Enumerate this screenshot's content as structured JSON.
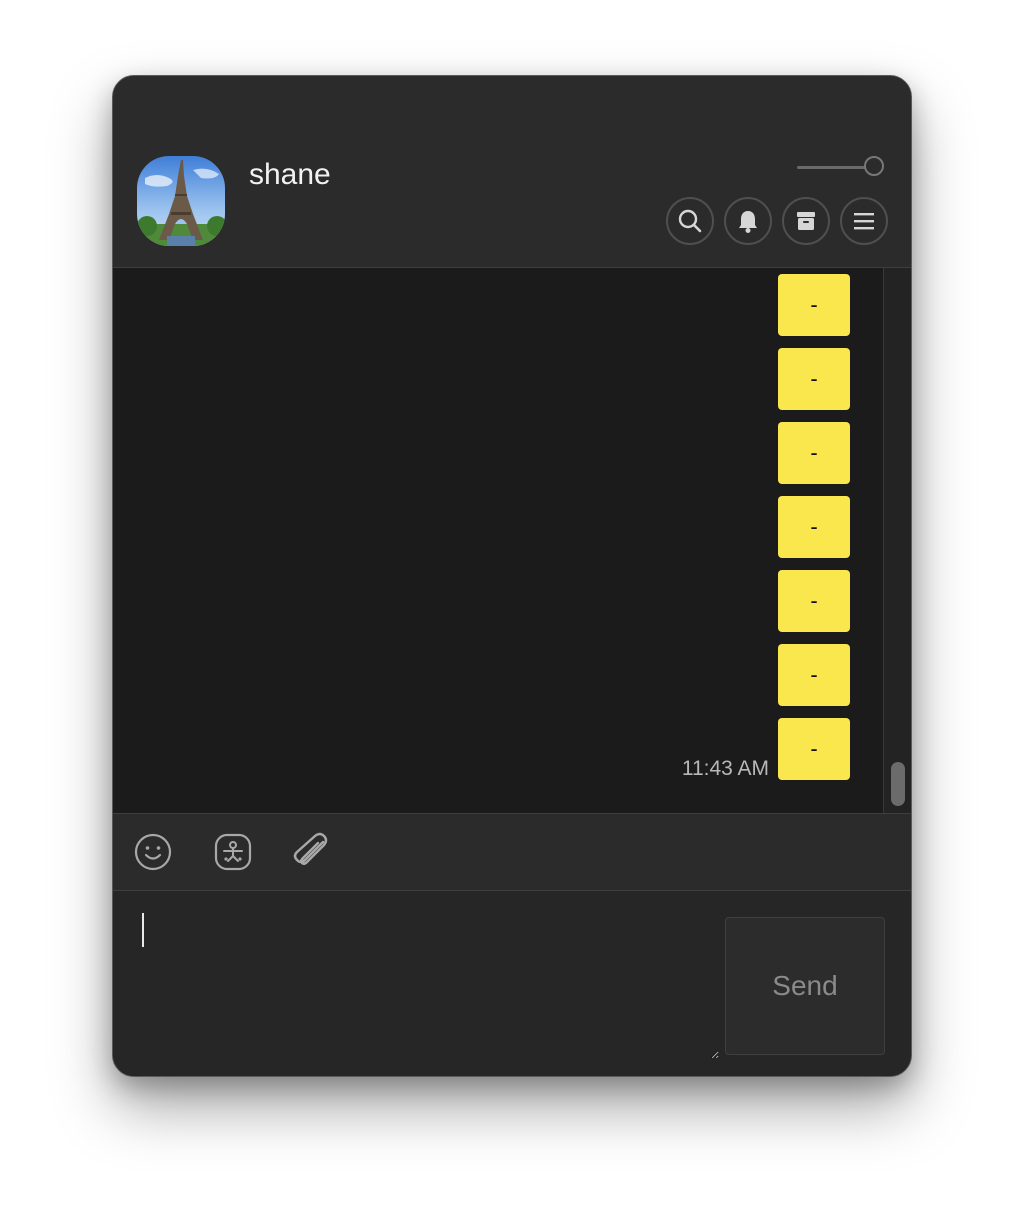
{
  "contact": {
    "name": "shane",
    "avatar": "eiffel-tower-photo"
  },
  "header": {
    "icons": [
      "search-icon",
      "bell-icon",
      "archive-icon",
      "menu-icon"
    ]
  },
  "messages": [
    {
      "text": "-"
    },
    {
      "text": "-"
    },
    {
      "text": "-"
    },
    {
      "text": "-"
    },
    {
      "text": "-"
    },
    {
      "text": "-"
    },
    {
      "text": "-",
      "time": "11:43 AM"
    }
  ],
  "toolbar": {
    "icons": [
      "emoji-icon",
      "sticker-icon",
      "paperclip-icon"
    ]
  },
  "compose": {
    "value": "",
    "send_label": "Send"
  },
  "colors": {
    "bubble": "#fae64d",
    "background": "#1b1b1b",
    "panel": "#2b2b2b"
  }
}
